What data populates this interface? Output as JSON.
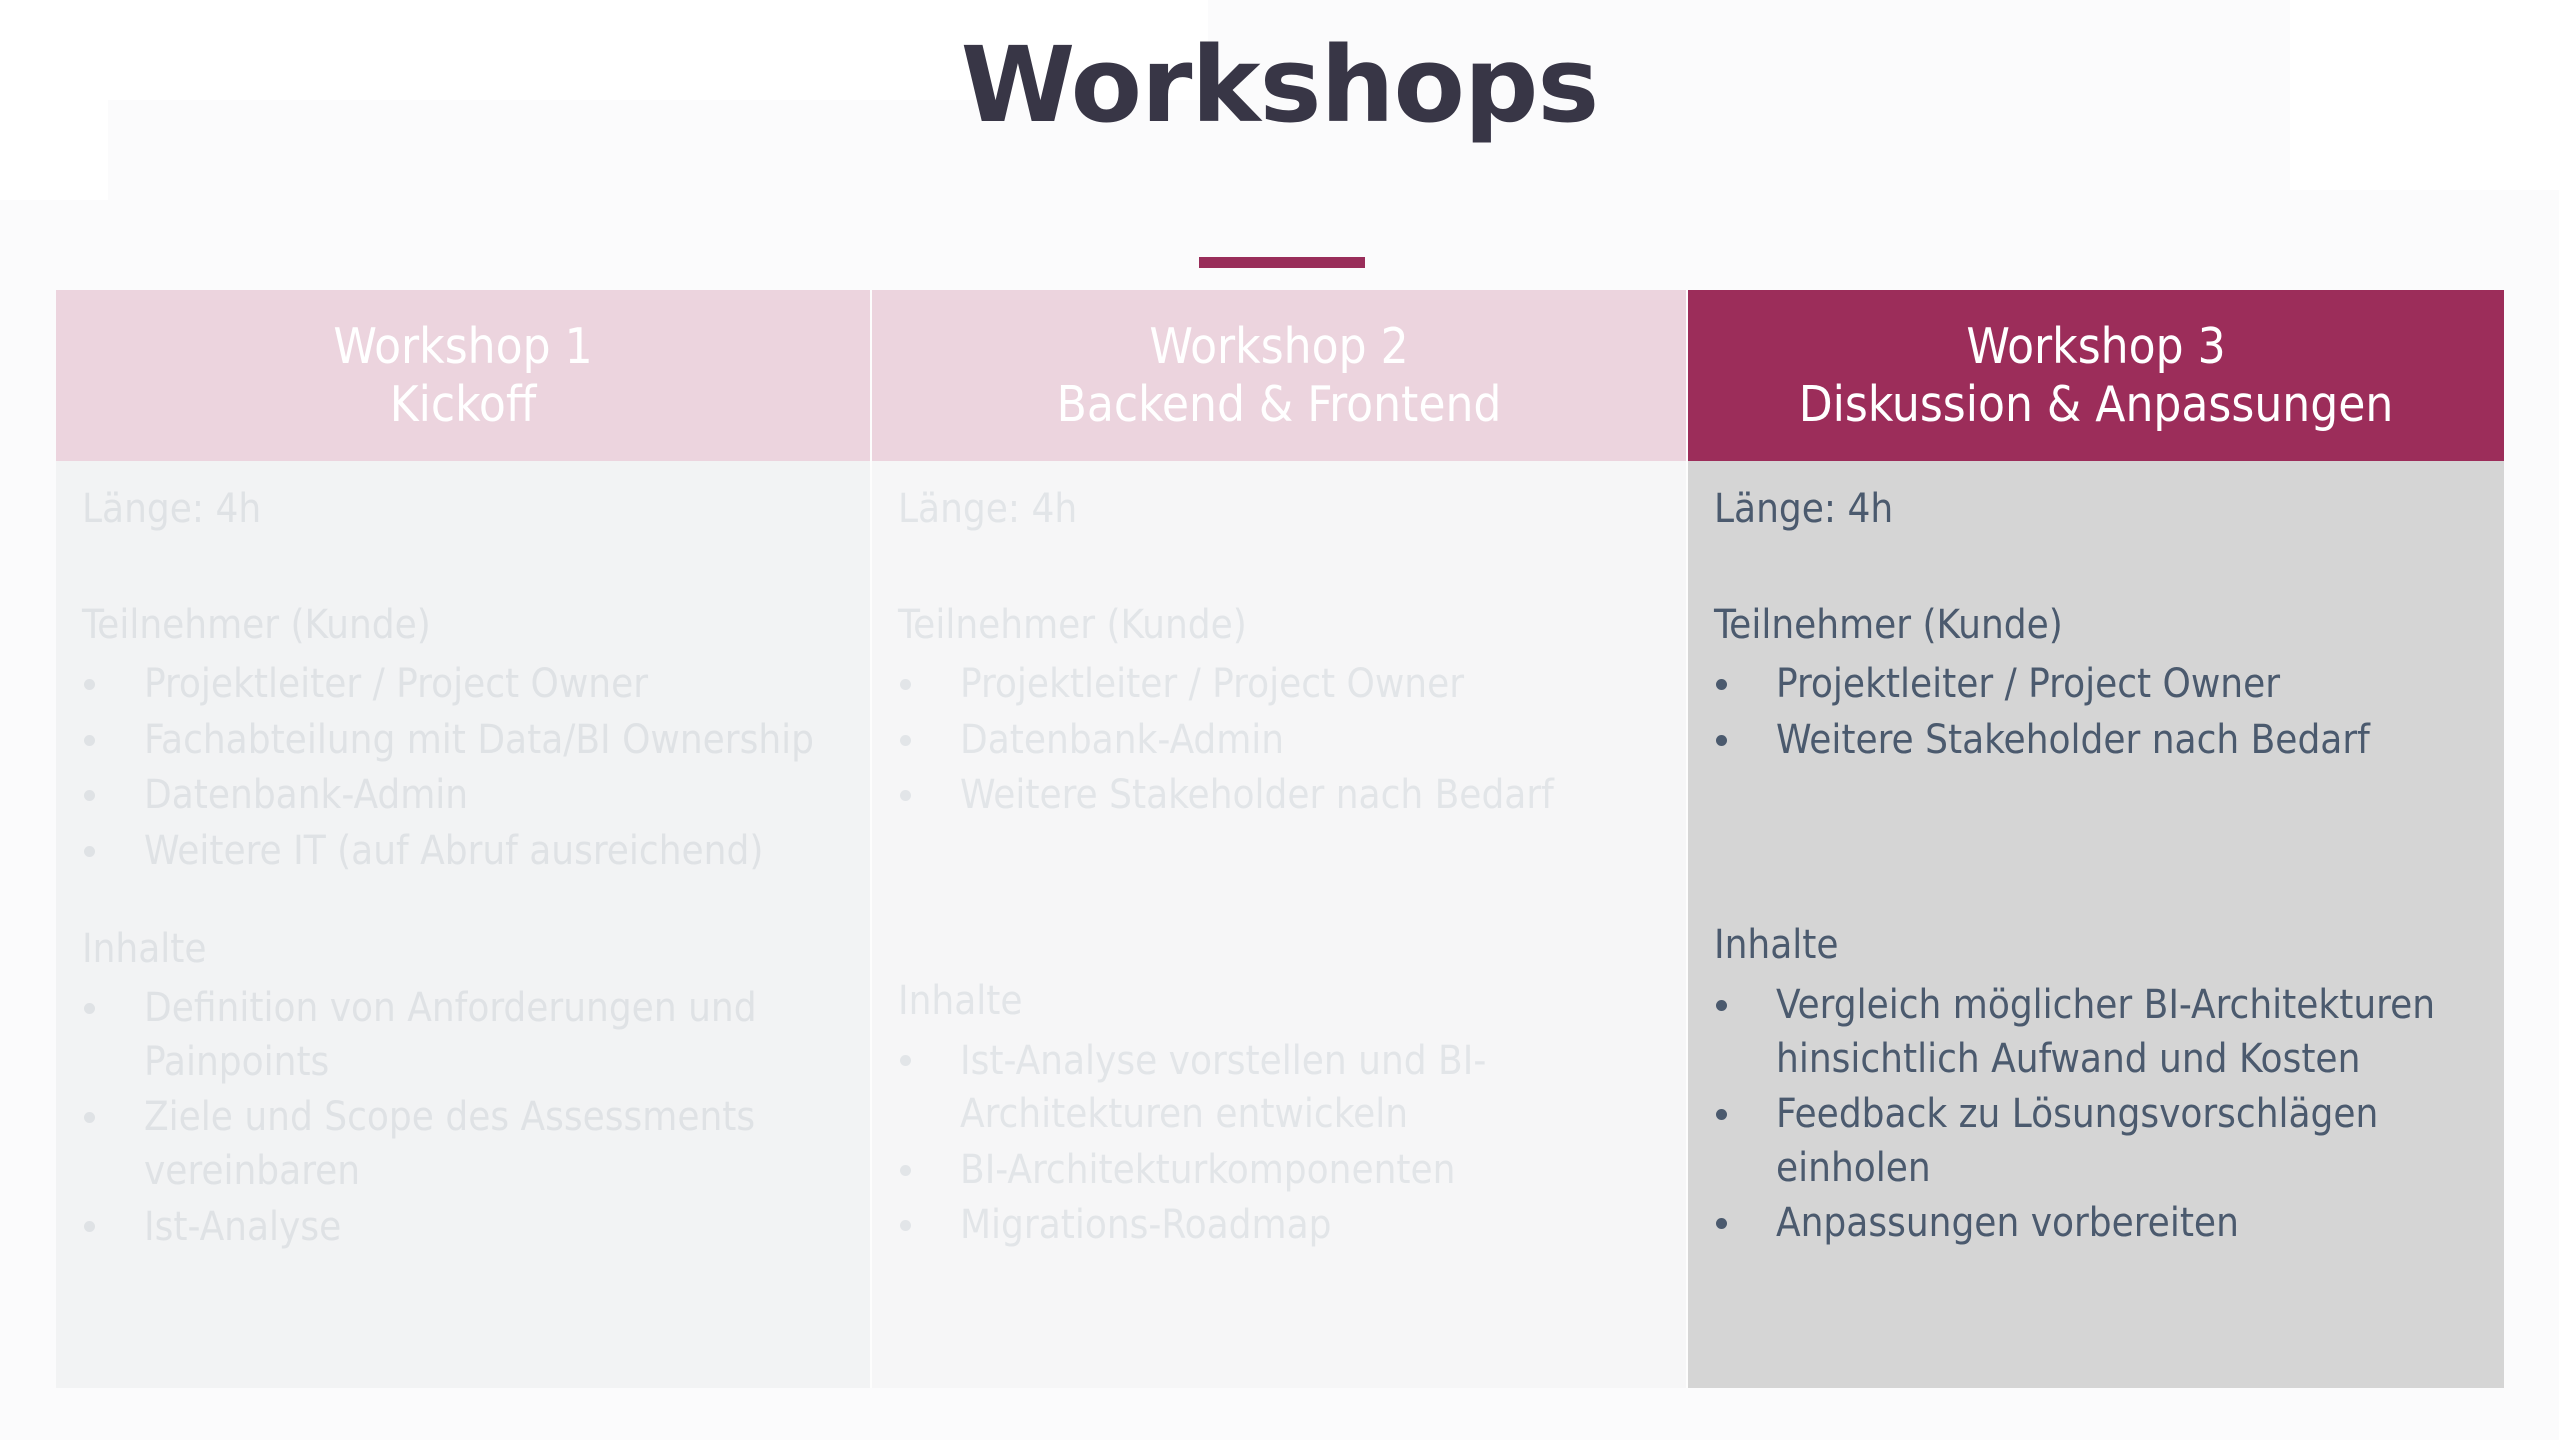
{
  "slide": {
    "title": "Workshops",
    "accent_color": "#992d5a",
    "title_color": "#383646"
  },
  "table": {
    "columns": [
      {
        "id": "workshop-1",
        "header_line1": "Workshop 1",
        "header_line2": "Kickoff",
        "header_bg": "#ecd4de",
        "body_bg": "#f2f3f4",
        "text_color": "#dfe2e5",
        "highlighted": false,
        "duration": "Länge: 4h",
        "participants_heading": "Teilnehmer (Kunde)",
        "participants": [
          "Projektleiter / Project Owner",
          "Fachabteilung mit Data/BI Ownership",
          "Datenbank-Admin",
          "Weitere IT (auf Abruf ausreichend)"
        ],
        "contents_heading": "Inhalte",
        "contents": [
          "Definition von Anforderungen und Painpoints",
          "Ziele und Scope des Assessments vereinbaren",
          "Ist-Analyse"
        ]
      },
      {
        "id": "workshop-2",
        "header_line1": "Workshop 2",
        "header_line2": "Backend & Frontend",
        "header_bg": "#ecd4de",
        "body_bg": "#f6f6f7",
        "text_color": "#e2e5e8",
        "highlighted": false,
        "duration": "Länge: 4h",
        "participants_heading": "Teilnehmer (Kunde)",
        "participants": [
          "Projektleiter / Project Owner",
          "Datenbank-Admin",
          "Weitere Stakeholder nach Bedarf"
        ],
        "contents_heading": "Inhalte",
        "contents": [
          "Ist-Analyse vorstellen und BI-Architekturen entwickeln",
          "BI-Architekturkomponenten",
          "Migrations-Roadmap"
        ]
      },
      {
        "id": "workshop-3",
        "header_line1": "Workshop 3",
        "header_line2": "Diskussion & Anpassungen",
        "header_bg": "#9c2d5a",
        "body_bg": "#d5d5d5",
        "text_color": "#4b5a6e",
        "highlighted": true,
        "duration": "Länge: 4h",
        "participants_heading": "Teilnehmer (Kunde)",
        "participants": [
          "Projektleiter / Project Owner",
          "Weitere Stakeholder nach Bedarf"
        ],
        "contents_heading": "Inhalte",
        "contents": [
          "Vergleich möglicher BI-Architekturen hinsichtlich Aufwand und Kosten",
          "Feedback zu Lösungsvorschlägen einholen",
          "Anpassungen vorbereiten"
        ]
      }
    ]
  }
}
